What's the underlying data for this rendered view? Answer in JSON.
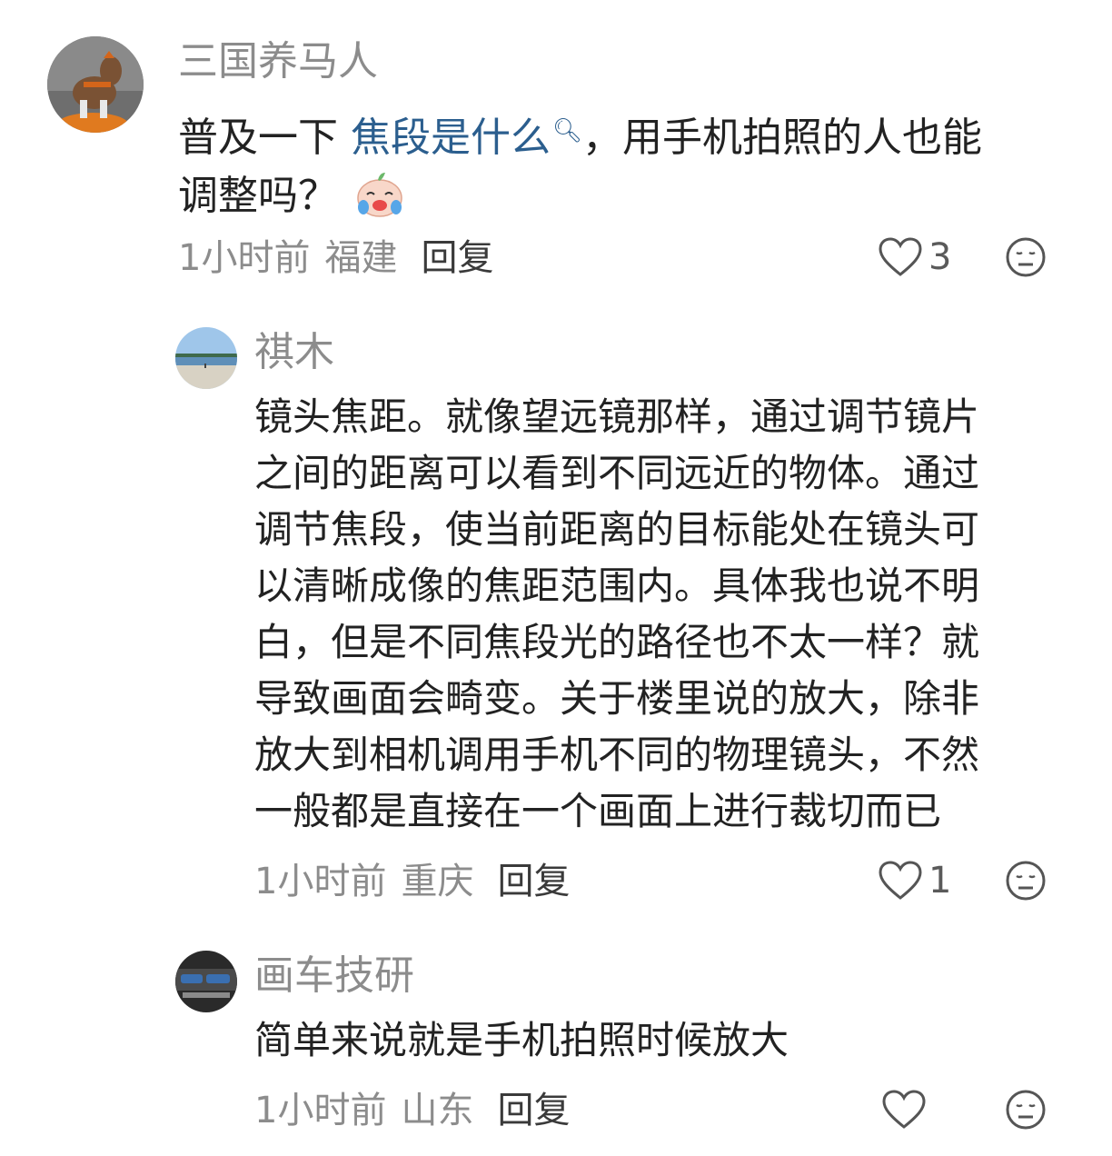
{
  "comments": [
    {
      "username": "三国养马人",
      "text_before": "普及一下 ",
      "keyword": "焦段是什么",
      "keyword_icon": "search-magnifier-icon",
      "text_line1_after": "，用手机拍照的人也能",
      "text_line2": "调整吗？",
      "emoji": "crying-laughing-emoji",
      "time": "1小时前",
      "location": "福建",
      "reply_label": "回复",
      "likes": "3"
    },
    {
      "username": "祺木",
      "lines": [
        "镜头焦距。就像望远镜那样，通过调节镜片",
        "之间的距离可以看到不同远近的物体。通过",
        "调节焦段，使当前距离的目标能处在镜头可",
        "以清晰成像的焦距范围内。具体我也说不明",
        "白，但是不同焦段光的路径也不太一样？就",
        "导致画面会畸变。关于楼里说的放大，除非",
        "放大到相机调用手机不同的物理镜头，不然",
        "一般都是直接在一个画面上进行裁切而已"
      ],
      "time": "1小时前",
      "location": "重庆",
      "reply_label": "回复",
      "likes": "1"
    },
    {
      "username": "画车技研",
      "text": "简单来说就是手机拍照时候放大",
      "time": "1小时前",
      "location": "山东",
      "reply_label": "回复",
      "likes": ""
    }
  ],
  "colors": {
    "username": "#8c8c8c",
    "text": "#222222",
    "keyword": "#2b5e8e",
    "meta": "#8c8c8c",
    "reply": "#3a3a3a"
  }
}
